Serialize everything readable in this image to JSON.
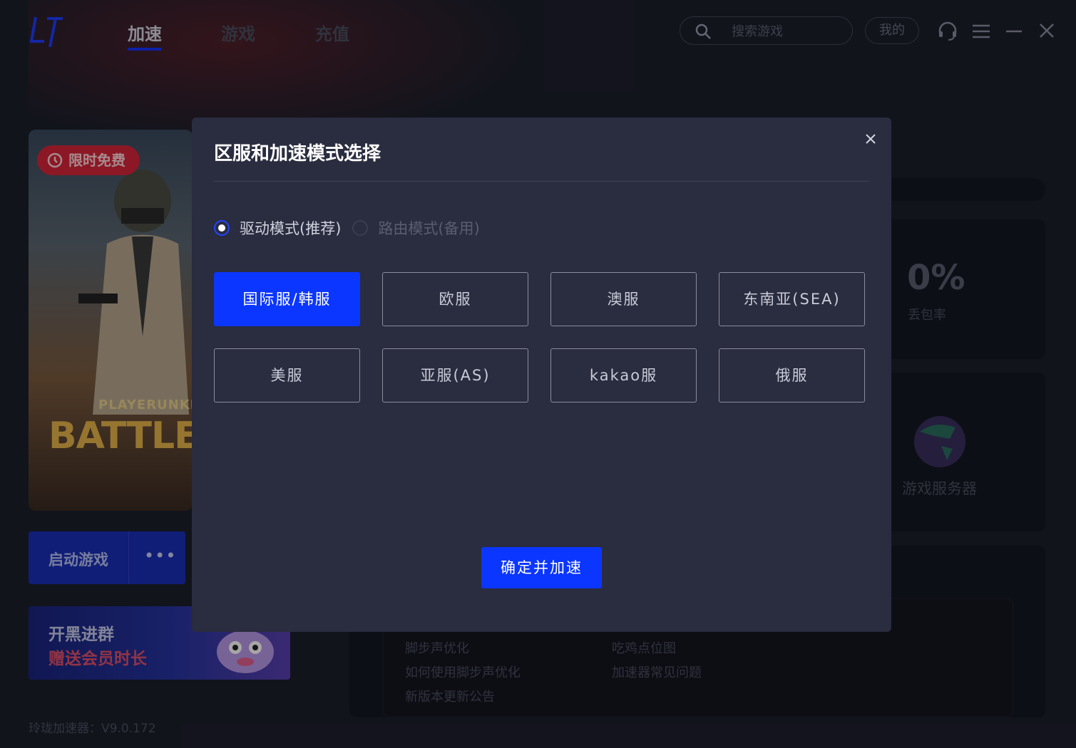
{
  "header": {
    "tabs": [
      {
        "label": "加速",
        "active": true
      },
      {
        "label": "游戏",
        "active": false
      },
      {
        "label": "充值",
        "active": false
      }
    ],
    "search_placeholder": "搜索游戏",
    "mine_label": "我的"
  },
  "game": {
    "badge": "限时免费",
    "title_small": "PLAYERUNKNOW",
    "title_big": "BATTLEGRO",
    "launch_label": "启动游戏",
    "more_label": "•••"
  },
  "promo": {
    "line1": "开黑进群",
    "line2": "赠送会员时长"
  },
  "version": "玲珑加速器：V9.0.172",
  "stats": {
    "loss_value": "0%",
    "loss_label": "丢包率",
    "server_label": "游戏服务器"
  },
  "links": [
    {
      "label": "脚步声优化"
    },
    {
      "label": "吃鸡点位图"
    },
    {
      "label": "如何使用脚步声优化"
    },
    {
      "label": "加速器常见问题"
    },
    {
      "label": "新版本更新公告"
    }
  ],
  "modal": {
    "title": "区服和加速模式选择",
    "modes": [
      {
        "label": "驱动模式(推荐)",
        "selected": true
      },
      {
        "label": "路由模式(备用)",
        "selected": false
      }
    ],
    "regions": [
      {
        "label": "国际服/韩服",
        "selected": true
      },
      {
        "label": "欧服",
        "selected": false
      },
      {
        "label": "澳服",
        "selected": false
      },
      {
        "label": "东南亚(SEA)",
        "selected": false
      },
      {
        "label": "美服",
        "selected": false
      },
      {
        "label": "亚服(AS)",
        "selected": false
      },
      {
        "label": "kakao服",
        "selected": false
      },
      {
        "label": "俄服",
        "selected": false
      }
    ],
    "confirm_label": "确定并加速"
  },
  "colors": {
    "accent": "#0b36ff",
    "badge_red": "#d8263a",
    "modal_bg": "#2a2c3f"
  }
}
